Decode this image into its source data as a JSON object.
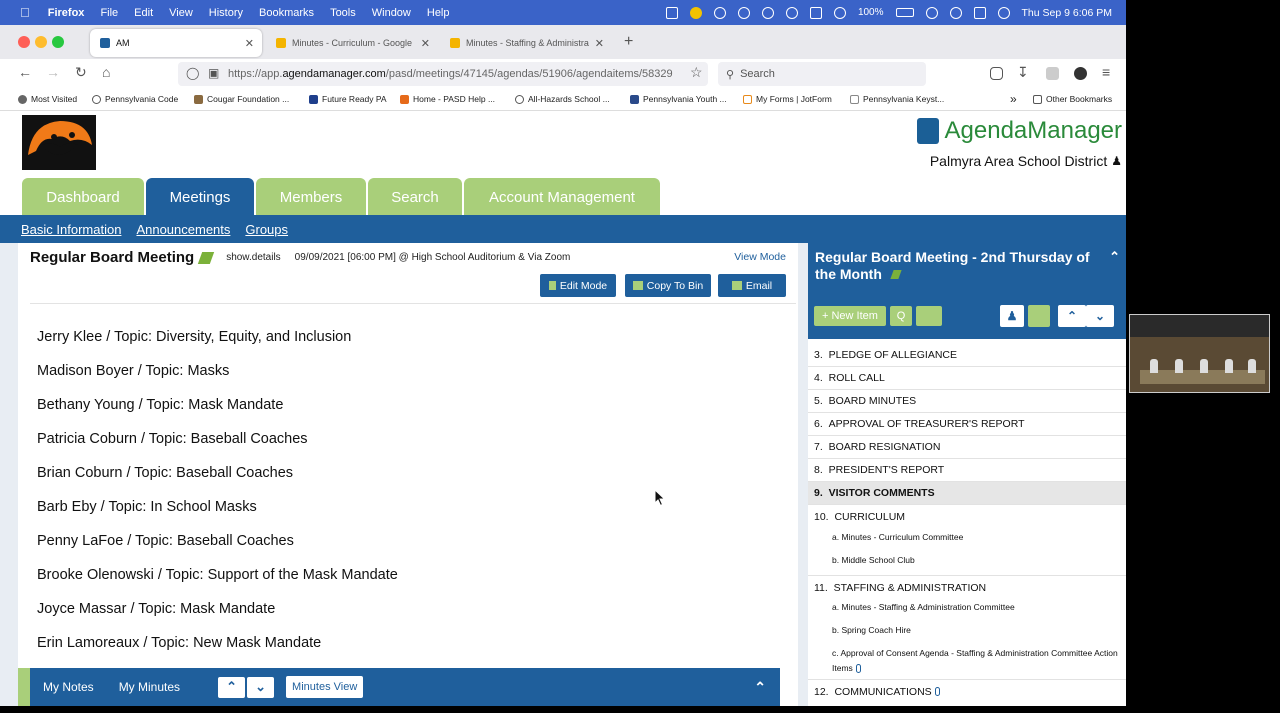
{
  "menubar": {
    "app": "Firefox",
    "items": [
      "File",
      "Edit",
      "View",
      "History",
      "Bookmarks",
      "Tools",
      "Window",
      "Help"
    ],
    "battery": "100%",
    "clock": "Thu Sep 9  6:06 PM"
  },
  "tabs": [
    {
      "label": "AM",
      "active": true
    },
    {
      "label": "Minutes - Curriculum - Google",
      "active": false
    },
    {
      "label": "Minutes - Staffing & Administra",
      "active": false
    }
  ],
  "nav": {
    "url_prefix": "https://app.",
    "url_domain": "agendamanager.com",
    "url_path": "/pasd/meetings/47145/agendas/51906/agendaitems/58329",
    "search_placeholder": "Search"
  },
  "bookmarks": [
    "Most Visited",
    "Pennsylvania Code",
    "Cougar Foundation ...",
    "Future Ready PA",
    "Home - PASD Help ...",
    "All-Hazards School ...",
    "Pennsylvania Youth ...",
    "My Forms | JotForm",
    "Pennsylvania Keyst...",
    "Other Bookmarks"
  ],
  "header": {
    "brand": "AgendaManager",
    "district": "Palmyra Area School District"
  },
  "main_tabs": [
    "Dashboard",
    "Meetings",
    "Members",
    "Search",
    "Account Management"
  ],
  "subnav": [
    "Basic Information",
    "Announcements",
    "Groups"
  ],
  "meeting": {
    "title": "Regular Board Meeting",
    "show_details": "show.details",
    "when": "09/09/2021 [06:00 PM] @ High School Auditorium & Via Zoom",
    "view_mode": "View Mode",
    "buttons": {
      "edit": "Edit Mode",
      "copy": "Copy To Bin",
      "email": "Email"
    },
    "topics": [
      "Jerry Klee / Topic: Diversity, Equity, and Inclusion",
      "Madison Boyer / Topic: Masks",
      "Bethany Young / Topic: Mask Mandate",
      "Patricia Coburn / Topic: Baseball Coaches",
      "Brian Coburn / Topic: Baseball Coaches",
      "Barb Eby / Topic: In School Masks",
      "Penny LaFoe / Topic: Baseball Coaches",
      "Brooke Olenowski / Topic: Support of the Mask Mandate",
      "Joyce Massar / Topic: Mask Mandate",
      "Erin Lamoreaux / Topic: New Mask Mandate"
    ]
  },
  "bottombar": {
    "notes": "My Notes",
    "minutes": "My Minutes",
    "minutes_view": "Minutes View"
  },
  "agenda": {
    "title": "Regular Board Meeting - 2nd Thursday of the Month",
    "new_item": "New Item",
    "q": "Q",
    "items": [
      {
        "num": "3.",
        "label": "PLEDGE OF ALLEGIANCE"
      },
      {
        "num": "4.",
        "label": "ROLL CALL"
      },
      {
        "num": "5.",
        "label": "BOARD MINUTES"
      },
      {
        "num": "6.",
        "label": "APPROVAL OF TREASURER'S REPORT"
      },
      {
        "num": "7.",
        "label": "BOARD RESIGNATION"
      },
      {
        "num": "8.",
        "label": "PRESIDENT'S REPORT"
      },
      {
        "num": "9.",
        "label": "VISITOR COMMENTS"
      },
      {
        "num": "10.",
        "label": "CURRICULUM"
      },
      {
        "num": "11.",
        "label": "STAFFING & ADMINISTRATION"
      },
      {
        "num": "12.",
        "label": "COMMUNICATIONS"
      }
    ],
    "sub10": [
      "a.  Minutes - Curriculum Committee",
      "b.  Middle School Club"
    ],
    "sub11": [
      "a.  Minutes - Staffing & Administration Committee",
      "b.  Spring Coach Hire",
      "c.  Approval of Consent Agenda - Staffing & Administration Committee Action Items"
    ]
  }
}
